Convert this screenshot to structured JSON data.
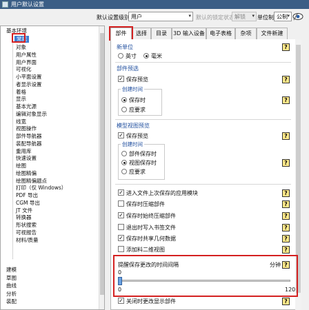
{
  "window": {
    "title": "用户默认设置"
  },
  "toolbar": {
    "level_label": "默认设置级别",
    "level_value": "用户",
    "lock_label": "默认的锁定状态",
    "lock_value": "解锁",
    "unit_label": "单位制",
    "unit_value": "公制"
  },
  "tree": {
    "root": "基本环境",
    "selected": "常规",
    "children": [
      "对象",
      "用户属性",
      "用户界面",
      "可视化",
      "小平面设置",
      "者显示设置",
      "着格",
      "显示",
      "基本光源",
      "编辑对象显示",
      "线宽",
      "视图操作",
      "部件导航器",
      "装配导航器",
      "重用库",
      "快速设置",
      "绘图",
      "绘图精偏",
      "绘图精偏题点",
      "打印（仅 Windows）",
      "PDF 导出",
      "CGM 导出",
      "JT 文件",
      "转换器",
      "形状搜索",
      "可视报告",
      "材料/质量"
    ],
    "top_level": [
      "建模",
      "草图",
      "曲线",
      "分析",
      "装配"
    ]
  },
  "tabs": [
    "部件",
    "选择",
    "目录",
    "3D 输入设备",
    "电子表格",
    "杂项",
    "文件新建"
  ],
  "active_tab": "部件",
  "content": {
    "units_title": "新单位",
    "unit_inch": "英寸",
    "unit_mm": "毫米",
    "part_preview_title": "部件预选",
    "save_preview": "保存预览",
    "create_time_legend": "创建时间",
    "on_save": "保存时",
    "on_demand": "应要求",
    "model_preview_title": "模型视图预览",
    "save_preview2": "保存预览",
    "create_time_legend2": "创建时间",
    "part_on_save": "部件保存时",
    "view_on_save": "视图保存时",
    "on_demand2": "应要求",
    "opt1": "进入文件上次保存的应用模块",
    "opt2": "保存时压缩部件",
    "opt3": "保存时始终压缩部件",
    "opt4": "退出时写入书签文件",
    "opt5": "保存时共享几何数据",
    "opt6": "添加料二维视图",
    "reminder_title": "提醒保存更改的时间间隔",
    "reminder_unit": "分钟",
    "slider_value": "0",
    "slider_min": "0",
    "slider_max": "120",
    "slider_fraction": 0,
    "last_opt": "关闭时更改显示部件"
  },
  "colors": {
    "accent": "#3d7fd3",
    "highlight": "#d42020",
    "title_blue": "#1f4e9e"
  }
}
